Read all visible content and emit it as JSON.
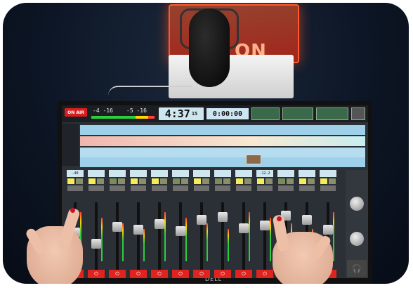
{
  "scene": {
    "on_air_sign_text": "ON",
    "monitor_brand": "DELL"
  },
  "console": {
    "on_air_button": "ON AIR",
    "level_left": "-4  -16",
    "level_right": "-5  -16",
    "clock": "4:37",
    "clock_seconds": "15",
    "timer": "0:00:00",
    "channel_level_readouts": [
      "-40",
      "-12.2"
    ],
    "headphone_icon": "headphones-icon",
    "accent_on_air": "#d81e1e",
    "accent_power": "#e0231f"
  }
}
